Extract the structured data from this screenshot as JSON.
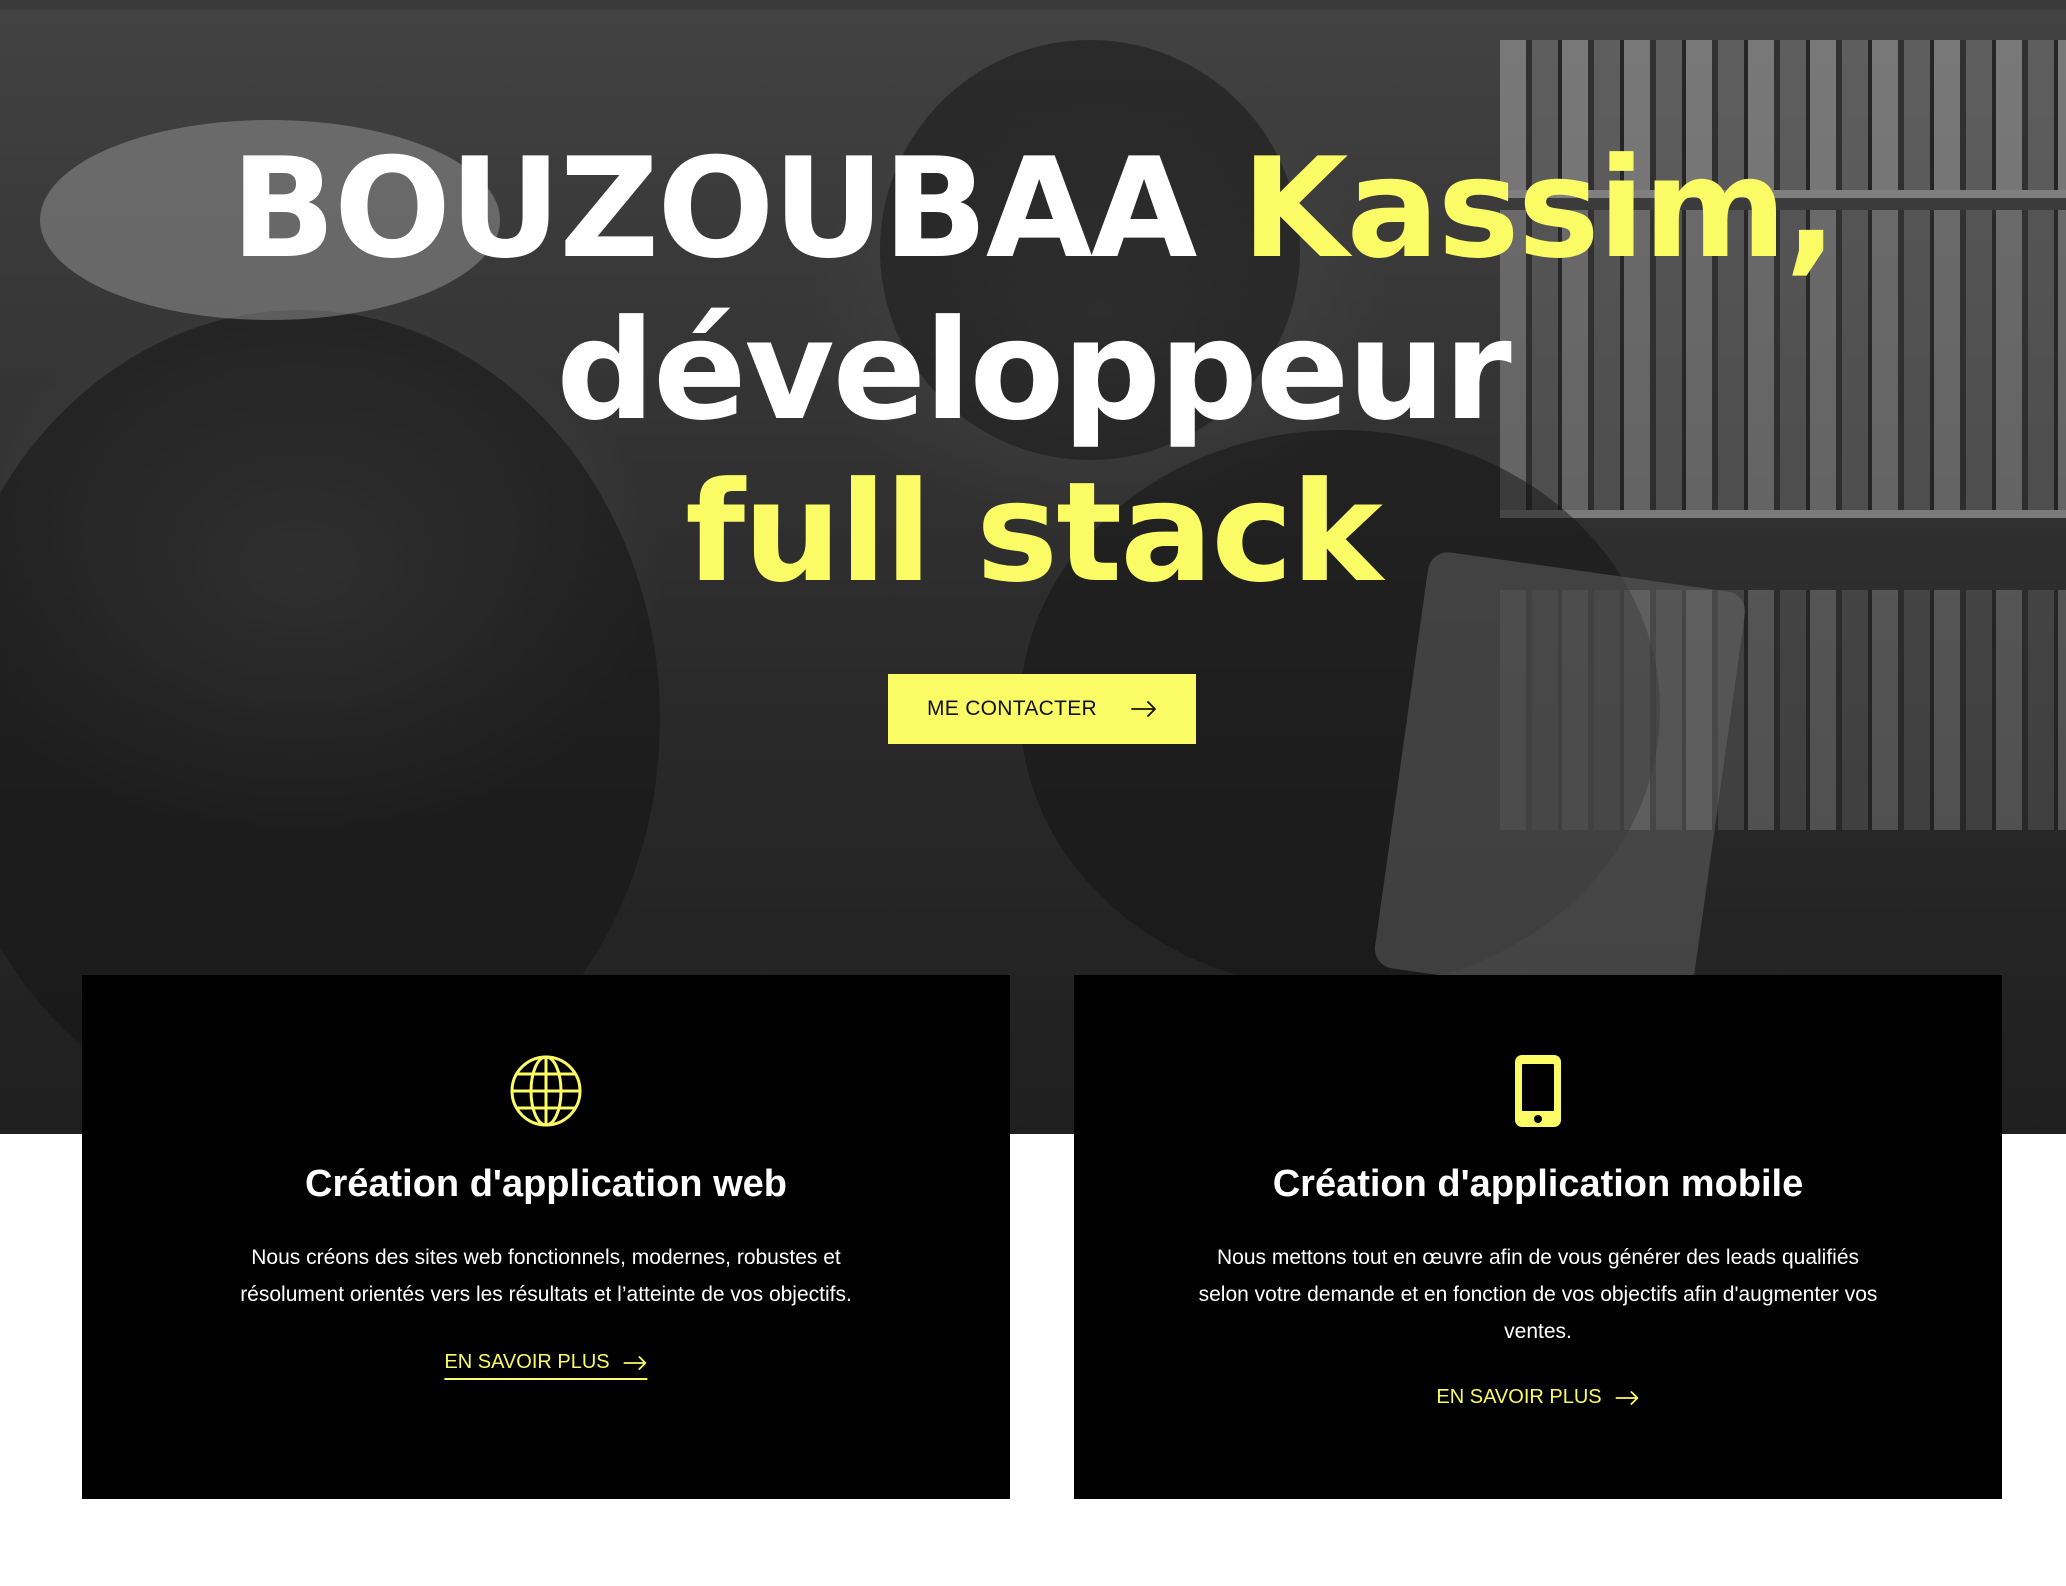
{
  "hero": {
    "title_part1": "BOUZOUBAA ",
    "title_name": "Kassim,",
    "title_part2": "développeur",
    "title_part3": "full stack",
    "cta_label": "ME CONTACTER",
    "cta_icon": "arrow-right-icon"
  },
  "services": [
    {
      "icon": "globe-icon",
      "title": "Création d'application web",
      "text_line1": "Nous créons des sites web fonctionnels, modernes, robustes et",
      "text_line2": "résolument orientés vers les résultats et l’atteinte de vos objectifs.",
      "link_label": "EN SAVOIR PLUS"
    },
    {
      "icon": "smartphone-icon",
      "title": "Création d'application mobile",
      "text_line1": "Nous mettons tout en œuvre afin de vous générer des leads qualifiés",
      "text_line2": "selon votre demande et en fonction de vos objectifs afin d'augmenter vos",
      "text_line3": "ventes.",
      "link_label": "EN SAVOIR PLUS"
    }
  ],
  "colors": {
    "accent": "#fbfb66",
    "card_bg": "#000000",
    "text": "#ffffff"
  }
}
